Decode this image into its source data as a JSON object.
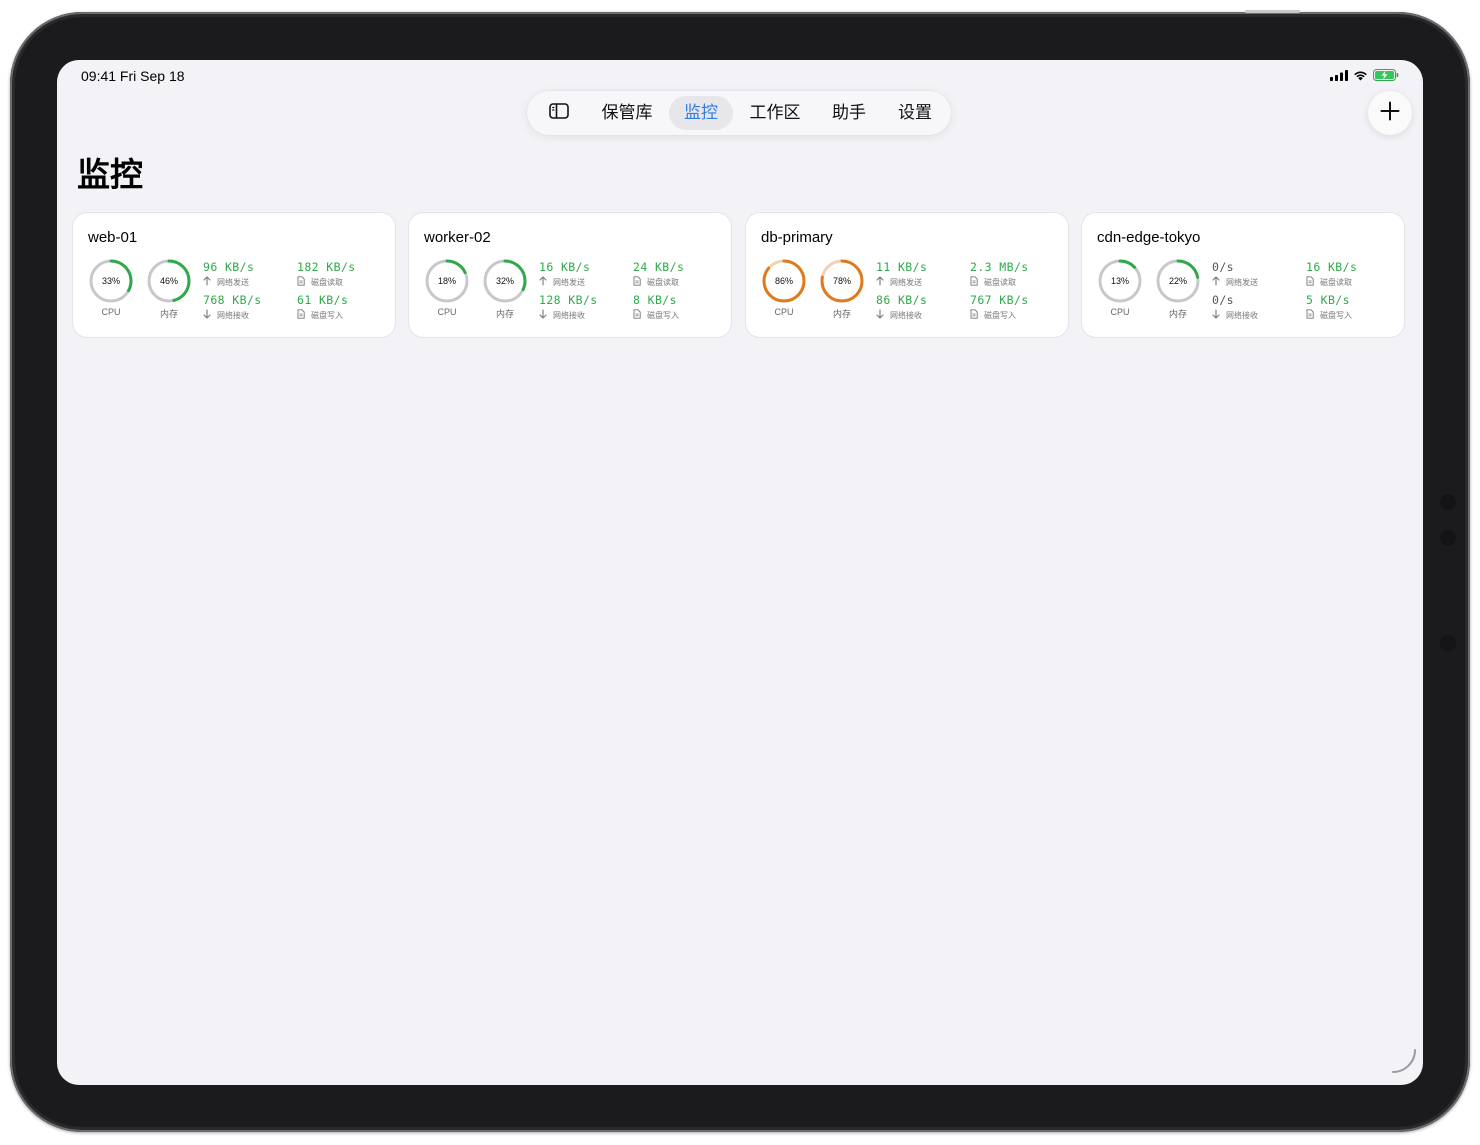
{
  "status_bar": {
    "time_date": "09:41  Fri Sep 18"
  },
  "tabs": [
    {
      "label": "保管库",
      "active": false
    },
    {
      "label": "监控",
      "active": true
    },
    {
      "label": "工作区",
      "active": false
    },
    {
      "label": "助手",
      "active": false
    },
    {
      "label": "设置",
      "active": false
    }
  ],
  "page_title": "监控",
  "labels": {
    "cpu": "CPU",
    "mem": "内存",
    "net_send": "网络发送",
    "net_recv": "网络接收",
    "disk_read": "磁盘读取",
    "disk_write": "磁盘写入"
  },
  "colors": {
    "accent": "#2f7ee0",
    "ok": "#2eaa4a",
    "warn": "#e07a1f",
    "track": "#c8c8cc"
  },
  "servers": [
    {
      "name": "web-01",
      "cpu": "33%",
      "cpu_pct": 33,
      "mem": "46%",
      "mem_pct": 46,
      "net_send": "96 KB/s",
      "net_recv": "768 KB/s",
      "disk_read": "182 KB/s",
      "disk_write": "61 KB/s"
    },
    {
      "name": "worker-02",
      "cpu": "18%",
      "cpu_pct": 18,
      "mem": "32%",
      "mem_pct": 32,
      "net_send": "16 KB/s",
      "net_recv": "128 KB/s",
      "disk_read": "24 KB/s",
      "disk_write": "8 KB/s"
    },
    {
      "name": "db-primary",
      "cpu": "86%",
      "cpu_pct": 86,
      "mem": "78%",
      "mem_pct": 78,
      "net_send": "11 KB/s",
      "net_recv": "86 KB/s",
      "disk_read": "2.3 MB/s",
      "disk_write": "767 KB/s"
    },
    {
      "name": "cdn-edge-tokyo",
      "cpu": "13%",
      "cpu_pct": 13,
      "mem": "22%",
      "mem_pct": 22,
      "net_send": "0/s",
      "net_recv": "0/s",
      "disk_read": "16 KB/s",
      "disk_write": "5 KB/s"
    }
  ]
}
